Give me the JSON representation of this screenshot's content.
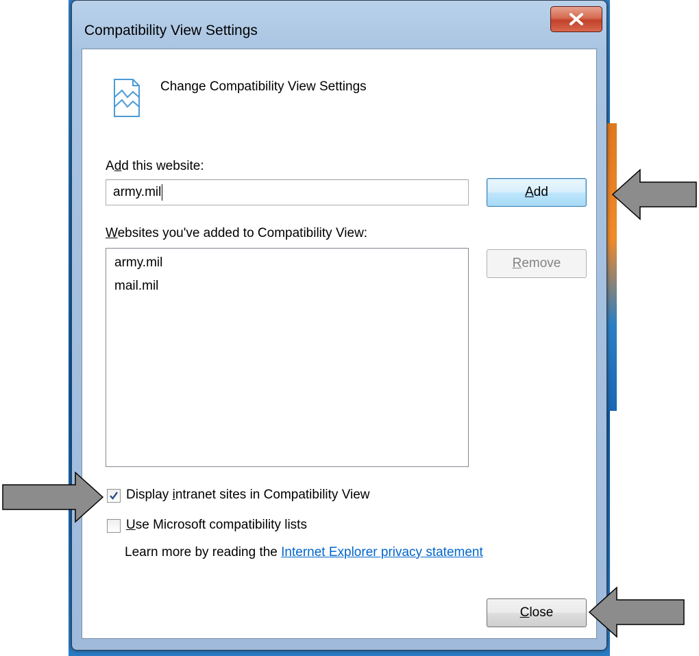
{
  "dialog": {
    "title": "Compatibility View Settings",
    "header_text": "Change Compatibility View Settings",
    "add_label_prefix": "A",
    "add_label_accel": "d",
    "add_label_suffix": "d this website:",
    "add_input_value": "army.mil",
    "add_button_accel": "A",
    "add_button_rest": "dd",
    "list_label_accel": "W",
    "list_label_rest": "ebsites you've added to Compatibility View:",
    "sites": [
      "army.mil",
      "mail.mil"
    ],
    "remove_button_accel": "R",
    "remove_button_rest": "emove",
    "intranet_checkbox": {
      "checked": true,
      "label_prefix": "Display ",
      "label_accel": "i",
      "label_suffix": "ntranet sites in Compatibility View"
    },
    "ms_lists_checkbox": {
      "checked": false,
      "label_accel": "U",
      "label_rest": "se Microsoft compatibility lists"
    },
    "learn_more_text": "Learn more by reading the ",
    "privacy_link": "Internet Explorer privacy statement",
    "close_button_accel": "C",
    "close_button_rest": "lose"
  },
  "icons": {
    "window_close": "close-x-icon",
    "header": "compatibility-view-icon",
    "checkmark": "checkmark-icon",
    "arrows": "gray-arrow-icon"
  },
  "colors": {
    "link": "#0066cc",
    "arrow_fill": "#8c8c8c",
    "title_close_red": "#c2412a"
  }
}
